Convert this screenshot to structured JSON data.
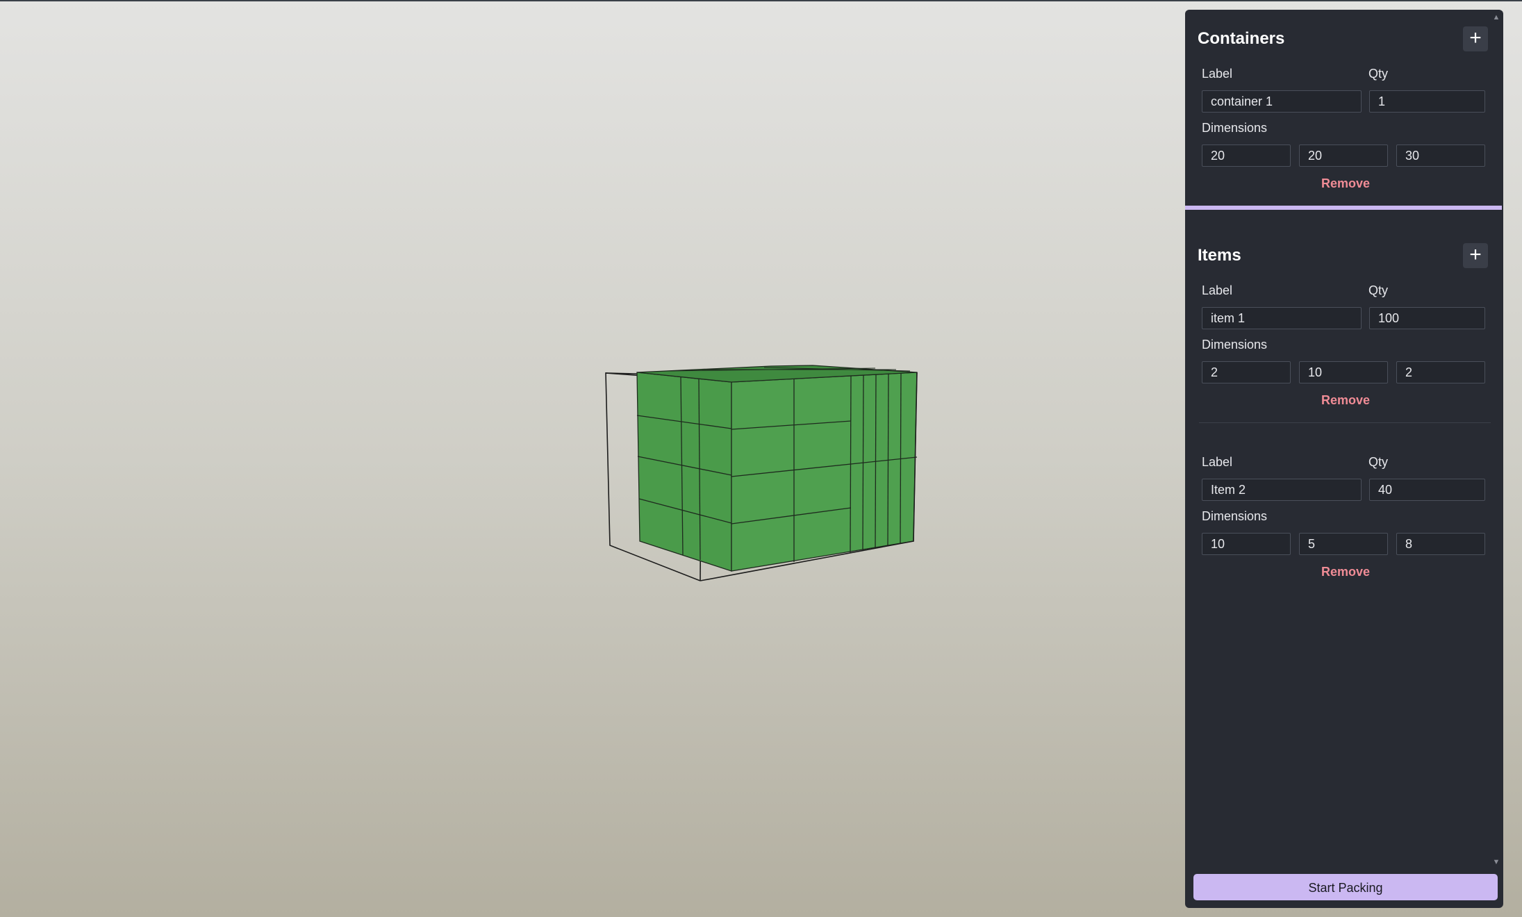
{
  "containers": {
    "title": "Containers",
    "add_label": "+",
    "items": [
      {
        "label_heading": "Label",
        "qty_heading": "Qty",
        "dimensions_heading": "Dimensions",
        "label": "container 1",
        "qty": "1",
        "dims": [
          "20",
          "20",
          "30"
        ],
        "remove_label": "Remove"
      }
    ]
  },
  "items": {
    "title": "Items",
    "add_label": "+",
    "items": [
      {
        "label_heading": "Label",
        "qty_heading": "Qty",
        "dimensions_heading": "Dimensions",
        "label": "item 1",
        "qty": "100",
        "dims": [
          "2",
          "10",
          "2"
        ],
        "remove_label": "Remove"
      },
      {
        "label_heading": "Label",
        "qty_heading": "Qty",
        "dimensions_heading": "Dimensions",
        "label": "Item 2",
        "qty": "40",
        "dims": [
          "10",
          "5",
          "8"
        ],
        "remove_label": "Remove"
      }
    ]
  },
  "footer": {
    "start_label": "Start Packing"
  },
  "colors": {
    "accent": "#cbb8f2",
    "panel_bg": "#282b33",
    "remove_text": "#f08c96",
    "packed_item_fill": "#4fa04f"
  },
  "scrollbar": {
    "up_icon": "scroll-up-arrow-icon",
    "down_icon": "scroll-down-arrow-icon"
  }
}
